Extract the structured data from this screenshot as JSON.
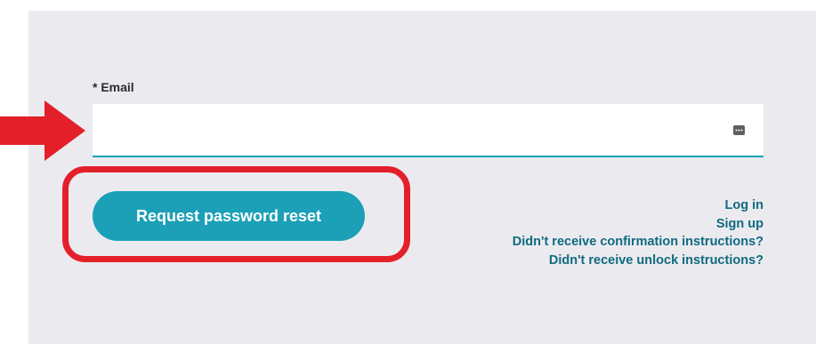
{
  "form": {
    "email_label": "* Email",
    "email_value": "",
    "submit_label": "Request password reset"
  },
  "links": {
    "log_in": "Log in",
    "sign_up": "Sign up",
    "confirmation": "Didn't receive confirmation instructions?",
    "unlock": "Didn't receive unlock instructions?"
  },
  "icons": {
    "field_autofill": "autofill-key-icon",
    "pointer": "red-arrow-right-icon",
    "highlight": "red-rounded-rectangle-annotation"
  },
  "colors": {
    "panel_background": "#ebebef",
    "button": "#1ca0b7",
    "link": "#106a80",
    "annotation": "#e3202a",
    "field_underline": "#1aa0b8"
  }
}
